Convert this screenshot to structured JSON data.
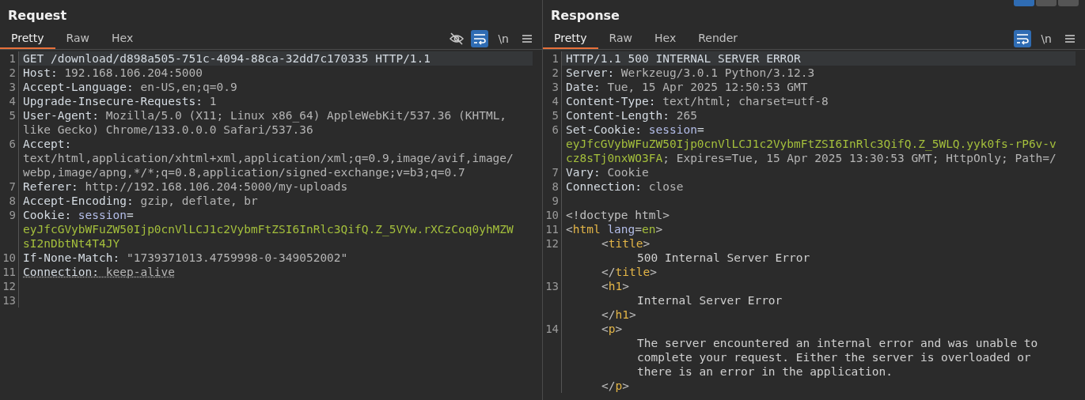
{
  "layout_buttons": [
    {
      "selected": true
    },
    {
      "selected": false
    },
    {
      "selected": false
    }
  ],
  "panels": [
    {
      "title": "Request",
      "tabs": [
        {
          "label": "Pretty",
          "selected": true
        },
        {
          "label": "Raw",
          "selected": false
        },
        {
          "label": "Hex",
          "selected": false
        }
      ],
      "tools": [
        {
          "kind": "hide",
          "on": false
        },
        {
          "kind": "wrap",
          "on": true
        },
        {
          "kind": "newline",
          "label": "\\n"
        },
        {
          "kind": "menu"
        }
      ],
      "lines": [
        {
          "number": "1",
          "selected": true,
          "rows": [
            {
              "kind": "top",
              "segments": [
                {
                  "kind": "name",
                  "text": "GET /download/d898a505-751c-4094-88ca-32dd7c170335 HTTP/1.1"
                }
              ]
            }
          ]
        },
        {
          "number": "2",
          "selected": false,
          "rows": [
            {
              "kind": "top",
              "segments": [
                {
                  "kind": "name",
                  "text": "Host:"
                },
                {
                  "kind": "value",
                  "text": " 192.168.106.204:5000"
                }
              ]
            }
          ]
        },
        {
          "number": "3",
          "selected": false,
          "rows": [
            {
              "kind": "top",
              "segments": [
                {
                  "kind": "name",
                  "text": "Accept-Language:"
                },
                {
                  "kind": "value",
                  "text": " en-US,en;q=0.9"
                }
              ]
            }
          ]
        },
        {
          "number": "4",
          "selected": false,
          "rows": [
            {
              "kind": "top",
              "segments": [
                {
                  "kind": "name",
                  "text": "Upgrade-Insecure-Requests:"
                },
                {
                  "kind": "value",
                  "text": " 1"
                }
              ]
            }
          ]
        },
        {
          "number": "5",
          "selected": false,
          "rows": [
            {
              "kind": "top",
              "segments": [
                {
                  "kind": "name",
                  "text": "User-Agent:"
                },
                {
                  "kind": "value",
                  "text": " Mozilla/5.0 (X11; Linux x86_64) AppleWebKit/537.36 (KHTML,"
                }
              ]
            },
            {
              "kind": "top",
              "segments": [
                {
                  "kind": "value",
                  "text": "like Gecko) Chrome/133.0.0.0 Safari/537.36"
                }
              ]
            }
          ]
        },
        {
          "number": "6",
          "selected": false,
          "rows": [
            {
              "kind": "top",
              "segments": [
                {
                  "kind": "name",
                  "text": "Accept:"
                }
              ]
            },
            {
              "kind": "top",
              "segments": [
                {
                  "kind": "value",
                  "text": "text/html,application/xhtml+xml,application/xml;q=0.9,image/avif,image/"
                }
              ]
            },
            {
              "kind": "top",
              "segments": [
                {
                  "kind": "value",
                  "text": "webp,image/apng,*/*;q=0.8,application/signed-exchange;v=b3;q=0.7"
                }
              ]
            }
          ]
        },
        {
          "number": "7",
          "selected": false,
          "rows": [
            {
              "kind": "top",
              "segments": [
                {
                  "kind": "name",
                  "text": "Referer:"
                },
                {
                  "kind": "value",
                  "text": " http://192.168.106.204:5000/my-uploads"
                }
              ]
            }
          ]
        },
        {
          "number": "8",
          "selected": false,
          "rows": [
            {
              "kind": "top",
              "segments": [
                {
                  "kind": "name",
                  "text": "Accept-Encoding:"
                },
                {
                  "kind": "value",
                  "text": " gzip, deflate, br"
                }
              ]
            }
          ]
        },
        {
          "number": "9",
          "selected": false,
          "rows": [
            {
              "kind": "top",
              "segments": [
                {
                  "kind": "name",
                  "text": "Cookie:"
                },
                {
                  "kind": "cookie-name",
                  "text": " session"
                },
                {
                  "kind": "name",
                  "text": "="
                }
              ]
            },
            {
              "kind": "top",
              "segments": [
                {
                  "kind": "cookie-value",
                  "text": "eyJfcGVybWFuZW50Ijp0cnVlLCJ1c2VybmFtZSI6InRlc3QifQ.Z_5VYw.rXCzCoq0yhMZW"
                }
              ]
            },
            {
              "kind": "top",
              "segments": [
                {
                  "kind": "cookie-value",
                  "text": "sI2nDbtNt4T4JY"
                }
              ]
            }
          ]
        },
        {
          "number": "10",
          "selected": false,
          "rows": [
            {
              "kind": "top",
              "segments": [
                {
                  "kind": "name",
                  "text": "If-None-Match:"
                },
                {
                  "kind": "value",
                  "text": " \"1739371013.4759998-0-349052002\""
                }
              ]
            }
          ]
        },
        {
          "number": "11",
          "selected": false,
          "flagged": true,
          "rows": [
            {
              "kind": "top",
              "segments": [
                {
                  "kind": "name",
                  "text": "Connection:"
                },
                {
                  "kind": "value",
                  "text": " keep-alive"
                }
              ]
            }
          ]
        },
        {
          "number": "12",
          "selected": false
        },
        {
          "number": "13",
          "selected": false
        }
      ]
    },
    {
      "title": "Response",
      "tabs": [
        {
          "label": "Pretty",
          "selected": true
        },
        {
          "label": "Raw",
          "selected": false
        },
        {
          "label": "Hex",
          "selected": false
        },
        {
          "label": "Render",
          "selected": false
        }
      ],
      "tools": [
        {
          "kind": "wrap",
          "on": true
        },
        {
          "kind": "newline",
          "label": "\\n"
        },
        {
          "kind": "menu"
        }
      ],
      "lines": [
        {
          "number": "1",
          "selected": true,
          "rows": [
            {
              "kind": "top",
              "segments": [
                {
                  "kind": "name",
                  "text": "HTTP/1.1 500 INTERNAL SERVER ERROR"
                }
              ]
            }
          ]
        },
        {
          "number": "2",
          "selected": false,
          "rows": [
            {
              "kind": "top",
              "segments": [
                {
                  "kind": "name",
                  "text": "Server:"
                },
                {
                  "kind": "value",
                  "text": " Werkzeug/3.0.1 Python/3.12.3"
                }
              ]
            }
          ]
        },
        {
          "number": "3",
          "selected": false,
          "rows": [
            {
              "kind": "top",
              "segments": [
                {
                  "kind": "name",
                  "text": "Date:"
                },
                {
                  "kind": "value",
                  "text": " Tue, 15 Apr 2025 12:50:53 GMT"
                }
              ]
            }
          ]
        },
        {
          "number": "4",
          "selected": false,
          "rows": [
            {
              "kind": "top",
              "segments": [
                {
                  "kind": "name",
                  "text": "Content-Type:"
                },
                {
                  "kind": "value",
                  "text": " text/html; charset=utf-8"
                }
              ]
            }
          ]
        },
        {
          "number": "5",
          "selected": false,
          "rows": [
            {
              "kind": "top",
              "segments": [
                {
                  "kind": "name",
                  "text": "Content-Length:"
                },
                {
                  "kind": "value",
                  "text": " 265"
                }
              ]
            }
          ]
        },
        {
          "number": "6",
          "selected": false,
          "rows": [
            {
              "kind": "top",
              "segments": [
                {
                  "kind": "name",
                  "text": "Set-Cookie:"
                },
                {
                  "kind": "cookie-name",
                  "text": " session"
                },
                {
                  "kind": "name",
                  "text": "="
                }
              ]
            },
            {
              "kind": "top",
              "segments": [
                {
                  "kind": "cookie-value",
                  "text": "eyJfcGVybWFuZW50Ijp0cnVlLCJ1c2VybmFtZSI6InRlc3QifQ.Z_5WLQ.yyk0fs-rP6v-v"
                }
              ]
            },
            {
              "kind": "top",
              "segments": [
                {
                  "kind": "cookie-value",
                  "text": "cz8sTj0nxWO3FA"
                },
                {
                  "kind": "value",
                  "text": "; Expires=Tue, 15 Apr 2025 13:30:53 GMT; HttpOnly; Path=/"
                }
              ]
            }
          ]
        },
        {
          "number": "7",
          "selected": false,
          "rows": [
            {
              "kind": "top",
              "segments": [
                {
                  "kind": "name",
                  "text": "Vary:"
                },
                {
                  "kind": "value",
                  "text": " Cookie"
                }
              ]
            }
          ]
        },
        {
          "number": "8",
          "selected": false,
          "rows": [
            {
              "kind": "top",
              "segments": [
                {
                  "kind": "name",
                  "text": "Connection:"
                },
                {
                  "kind": "value",
                  "text": " close"
                }
              ]
            }
          ]
        },
        {
          "number": "9",
          "selected": false
        },
        {
          "number": "10",
          "selected": false,
          "rows": [
            {
              "kind": "top",
              "segments": [
                {
                  "kind": "punct",
                  "text": "<!doctype html>"
                }
              ]
            }
          ]
        },
        {
          "number": "11",
          "selected": false,
          "rows": [
            {
              "kind": "top",
              "segments": [
                {
                  "kind": "punct",
                  "text": "<"
                },
                {
                  "kind": "tag",
                  "text": "html"
                },
                {
                  "kind": "attr",
                  "text": " lang"
                },
                {
                  "kind": "punct",
                  "text": "="
                },
                {
                  "kind": "attr-value",
                  "text": "en"
                },
                {
                  "kind": "punct",
                  "text": ">"
                }
              ]
            }
          ]
        },
        {
          "number": "12",
          "selected": false,
          "rows": [
            {
              "kind": "inner",
              "segments": [
                {
                  "kind": "punct",
                  "text": "<"
                },
                {
                  "kind": "tag",
                  "text": "title"
                },
                {
                  "kind": "punct",
                  "text": ">"
                }
              ]
            },
            {
              "kind": "nested",
              "segments": [
                {
                  "kind": "text",
                  "text": "500 Internal Server Error"
                }
              ]
            },
            {
              "kind": "inner",
              "segments": [
                {
                  "kind": "punct",
                  "text": "</"
                },
                {
                  "kind": "tag",
                  "text": "title"
                },
                {
                  "kind": "punct",
                  "text": ">"
                }
              ]
            }
          ]
        },
        {
          "number": "13",
          "selected": false,
          "rows": [
            {
              "kind": "inner",
              "segments": [
                {
                  "kind": "punct",
                  "text": "<"
                },
                {
                  "kind": "tag",
                  "text": "h1"
                },
                {
                  "kind": "punct",
                  "text": ">"
                }
              ]
            },
            {
              "kind": "nested",
              "segments": [
                {
                  "kind": "text",
                  "text": "Internal Server Error"
                }
              ]
            },
            {
              "kind": "inner",
              "segments": [
                {
                  "kind": "punct",
                  "text": "</"
                },
                {
                  "kind": "tag",
                  "text": "h1"
                },
                {
                  "kind": "punct",
                  "text": ">"
                }
              ]
            }
          ]
        },
        {
          "number": "14",
          "selected": false,
          "rows": [
            {
              "kind": "inner",
              "segments": [
                {
                  "kind": "punct",
                  "text": "<"
                },
                {
                  "kind": "tag",
                  "text": "p"
                },
                {
                  "kind": "punct",
                  "text": ">"
                }
              ]
            },
            {
              "kind": "nested",
              "segments": [
                {
                  "kind": "text",
                  "text": "The server encountered an internal error and was unable to"
                }
              ]
            },
            {
              "kind": "nested",
              "segments": [
                {
                  "kind": "text",
                  "text": "complete your request. Either the server is overloaded or"
                }
              ]
            },
            {
              "kind": "nested",
              "segments": [
                {
                  "kind": "text",
                  "text": "there is an error in the application."
                }
              ]
            },
            {
              "kind": "inner",
              "segments": [
                {
                  "kind": "punct",
                  "text": "</"
                },
                {
                  "kind": "tag",
                  "text": "p"
                },
                {
                  "kind": "punct",
                  "text": ">"
                }
              ]
            }
          ]
        }
      ]
    }
  ]
}
